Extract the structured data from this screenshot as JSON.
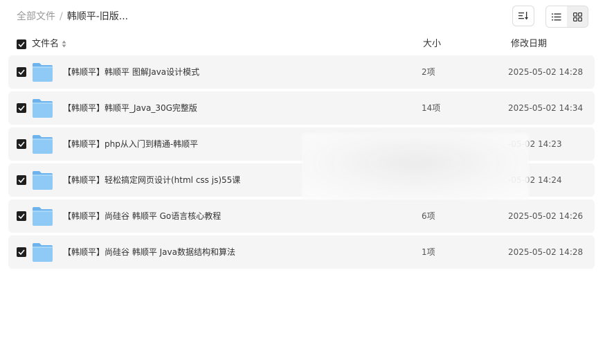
{
  "breadcrumb": {
    "root": "全部文件",
    "separator": "/",
    "current": "韩顺平-旧版..."
  },
  "toolbar": {
    "sort_icon": "sort-lines-icon",
    "list_view_icon": "list-view-icon",
    "grid_view_icon": "grid-view-icon",
    "active_view": "list"
  },
  "table": {
    "headers": {
      "name": "文件名",
      "size": "大小",
      "modified": "修改日期"
    },
    "rows": [
      {
        "name": "【韩顺平】韩顺平 图解Java设计模式",
        "size": "2项",
        "date": "2025-05-02 14:28",
        "checked": true
      },
      {
        "name": "【韩顺平】韩顺平_Java_30G完整版",
        "size": "14项",
        "date": "2025-05-02 14:34",
        "checked": true
      },
      {
        "name": "【韩顺平】php从入门到精通-韩顺平",
        "size": "",
        "date": "-05-02 14:23",
        "checked": true
      },
      {
        "name": "【韩顺平】轻松搞定网页设计(html css js)55课",
        "size": "",
        "date": "-05-02 14:24",
        "checked": true
      },
      {
        "name": "【韩顺平】尚硅谷 韩顺平 Go语言核心教程",
        "size": "6项",
        "date": "2025-05-02 14:26",
        "checked": true
      },
      {
        "name": "【韩顺平】尚硅谷 韩顺平 Java数据结构和算法",
        "size": "1项",
        "date": "2025-05-02 14:28",
        "checked": true
      }
    ]
  },
  "colors": {
    "row_bg": "#f5f5f6",
    "checkbox": "#1f1f1f",
    "folder_light": "#8fc9f5",
    "folder_dark": "#6db3ee"
  }
}
